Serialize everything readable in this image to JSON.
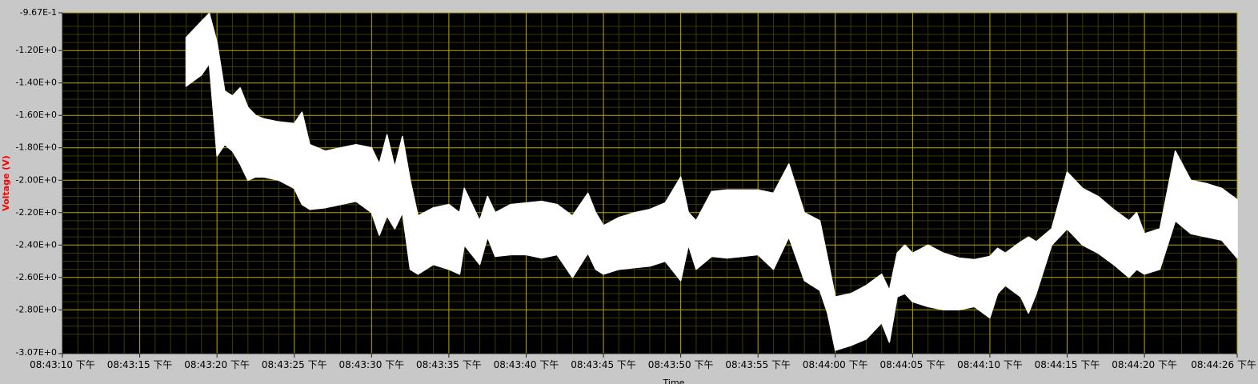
{
  "chart_data": {
    "type": "line",
    "title": "",
    "xlabel": "Time",
    "ylabel": "Voltage (V)",
    "ylim": [
      -3.07,
      -0.967
    ],
    "xlim": [
      "08:43:10 下午",
      "08:44:26 下午"
    ],
    "yticks": [
      "-9.67E-1",
      "-1.20E+0",
      "-1.40E+0",
      "-1.60E+0",
      "-1.80E+0",
      "-2.00E+0",
      "-2.20E+0",
      "-2.40E+0",
      "-2.60E+0",
      "-2.80E+0",
      "-3.07E+0"
    ],
    "xticks": [
      "08:43:10 下午",
      "08:43:15 下午",
      "08:43:20 下午",
      "08:43:25 下午",
      "08:43:30 下午",
      "08:43:35 下午",
      "08:43:40 下午",
      "08:43:45 下午",
      "08:43:50 下午",
      "08:43:55 下午",
      "08:44:00 下午",
      "08:44:05 下午",
      "08:44:10 下午",
      "08:44:15 下午",
      "08:44:20 下午",
      "08:44:26 下午"
    ],
    "grid": true,
    "colors": {
      "plot_background": "#000000",
      "grid_major": "#b8a800",
      "grid_minor": "#3c3a00",
      "signal": "#ffffff",
      "frame": "#c8c8c8",
      "ylabel": "#ff0000"
    },
    "series": [
      {
        "x": [
          "08:43:18",
          "08:43:19",
          "08:43:19.5",
          "08:43:20",
          "08:43:20.5",
          "08:43:21",
          "08:43:21.5",
          "08:43:22",
          "08:43:22.5",
          "08:43:23",
          "08:43:24",
          "08:43:25",
          "08:43:25.5",
          "08:43:26",
          "08:43:27",
          "08:43:28",
          "08:43:29",
          "08:43:30",
          "08:43:30.5",
          "08:43:31",
          "08:43:31.5",
          "08:43:32",
          "08:43:32.5",
          "08:43:33",
          "08:43:34",
          "08:43:35",
          "08:43:35.7",
          "08:43:36",
          "08:43:37",
          "08:43:37.5",
          "08:43:38",
          "08:43:39",
          "08:43:40",
          "08:43:41",
          "08:43:42",
          "08:43:43",
          "08:43:44",
          "08:43:44.5",
          "08:43:45",
          "08:43:46",
          "08:43:47",
          "08:43:48",
          "08:43:49",
          "08:43:50",
          "08:43:50.5",
          "08:43:51",
          "08:43:52",
          "08:43:53",
          "08:43:54",
          "08:43:55",
          "08:43:56",
          "08:43:57",
          "08:43:58",
          "08:43:59",
          "08:43:59.5",
          "08:44:00",
          "08:44:01",
          "08:44:02",
          "08:44:03",
          "08:44:03.5",
          "08:44:04",
          "08:44:04.5",
          "08:44:05",
          "08:44:06",
          "08:44:07",
          "08:44:08",
          "08:44:09",
          "08:44:10",
          "08:44:10.5",
          "08:44:11",
          "08:44:12",
          "08:44:12.5",
          "08:44:13",
          "08:44:14",
          "08:44:15",
          "08:44:16",
          "08:44:17",
          "08:44:18",
          "08:44:19",
          "08:44:19.5",
          "08:44:20",
          "08:44:21",
          "08:44:22",
          "08:44:23",
          "08:44:24",
          "08:44:25",
          "08:44:26"
        ],
        "y_max": [
          -1.12,
          -1.02,
          -0.97,
          -1.15,
          -1.45,
          -1.48,
          -1.43,
          -1.55,
          -1.6,
          -1.62,
          -1.64,
          -1.65,
          -1.58,
          -1.78,
          -1.82,
          -1.8,
          -1.78,
          -1.8,
          -1.9,
          -1.72,
          -1.92,
          -1.73,
          -2.0,
          -2.22,
          -2.17,
          -2.15,
          -2.2,
          -2.05,
          -2.25,
          -2.1,
          -2.2,
          -2.15,
          -2.14,
          -2.13,
          -2.15,
          -2.22,
          -2.08,
          -2.2,
          -2.28,
          -2.23,
          -2.2,
          -2.18,
          -2.14,
          -1.98,
          -2.2,
          -2.25,
          -2.07,
          -2.06,
          -2.06,
          -2.06,
          -2.08,
          -1.9,
          -2.2,
          -2.25,
          -2.48,
          -2.72,
          -2.7,
          -2.65,
          -2.58,
          -2.68,
          -2.45,
          -2.4,
          -2.45,
          -2.4,
          -2.45,
          -2.48,
          -2.49,
          -2.47,
          -2.42,
          -2.45,
          -2.38,
          -2.35,
          -2.38,
          -2.3,
          -1.95,
          -2.05,
          -2.1,
          -2.18,
          -2.25,
          -2.2,
          -2.33,
          -2.3,
          -1.82,
          -2.0,
          -2.02,
          -2.05,
          -2.12
        ],
        "y_min": [
          -1.42,
          -1.35,
          -1.28,
          -1.85,
          -1.78,
          -1.82,
          -1.9,
          -2.0,
          -1.98,
          -1.98,
          -2.0,
          -2.05,
          -2.15,
          -2.18,
          -2.17,
          -2.15,
          -2.13,
          -2.2,
          -2.34,
          -2.22,
          -2.3,
          -2.2,
          -2.55,
          -2.58,
          -2.52,
          -2.55,
          -2.58,
          -2.4,
          -2.52,
          -2.35,
          -2.47,
          -2.46,
          -2.46,
          -2.48,
          -2.46,
          -2.6,
          -2.45,
          -2.55,
          -2.58,
          -2.55,
          -2.54,
          -2.53,
          -2.5,
          -2.62,
          -2.4,
          -2.55,
          -2.47,
          -2.48,
          -2.47,
          -2.46,
          -2.55,
          -2.35,
          -2.62,
          -2.68,
          -2.82,
          -3.05,
          -3.02,
          -2.98,
          -2.88,
          -3.0,
          -2.72,
          -2.7,
          -2.75,
          -2.78,
          -2.8,
          -2.8,
          -2.78,
          -2.85,
          -2.7,
          -2.65,
          -2.72,
          -2.82,
          -2.7,
          -2.4,
          -2.3,
          -2.4,
          -2.45,
          -2.52,
          -2.6,
          -2.55,
          -2.58,
          -2.55,
          -2.25,
          -2.33,
          -2.35,
          -2.37,
          -2.48
        ]
      }
    ]
  }
}
